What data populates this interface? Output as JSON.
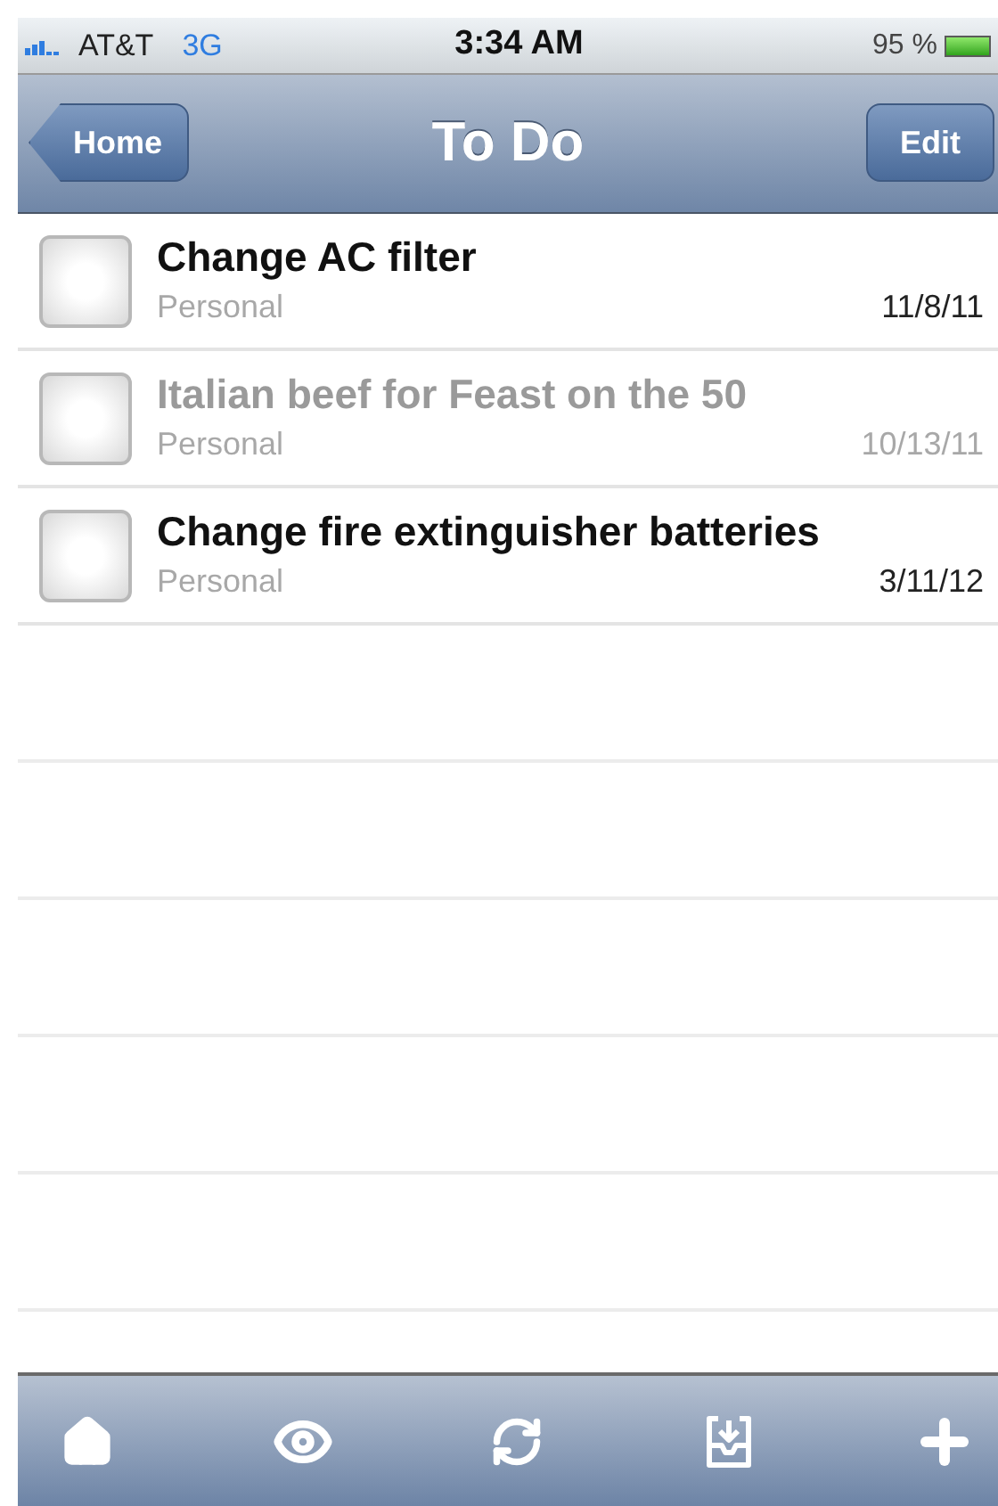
{
  "status_bar": {
    "carrier": "AT&T",
    "network": "3G",
    "time": "3:34 AM",
    "battery": "95 %"
  },
  "nav_bar": {
    "back_button": "Home",
    "title": "To Do",
    "edit_button": "Edit"
  },
  "tasks": [
    {
      "title": "Change AC filter",
      "category": "Personal",
      "date": "11/8/11",
      "checked": false,
      "dimmed": false
    },
    {
      "title": "Italian beef for Feast on the 50",
      "category": "Personal",
      "date": "10/13/11",
      "checked": false,
      "dimmed": true
    },
    {
      "title": "Change fire extinguisher batteries",
      "category": "Personal",
      "date": "3/11/12",
      "checked": false,
      "dimmed": false
    }
  ],
  "toolbar": [
    {
      "kind": "home"
    },
    {
      "kind": "view"
    },
    {
      "kind": "sync"
    },
    {
      "kind": "inbox"
    },
    {
      "kind": "add"
    }
  ]
}
